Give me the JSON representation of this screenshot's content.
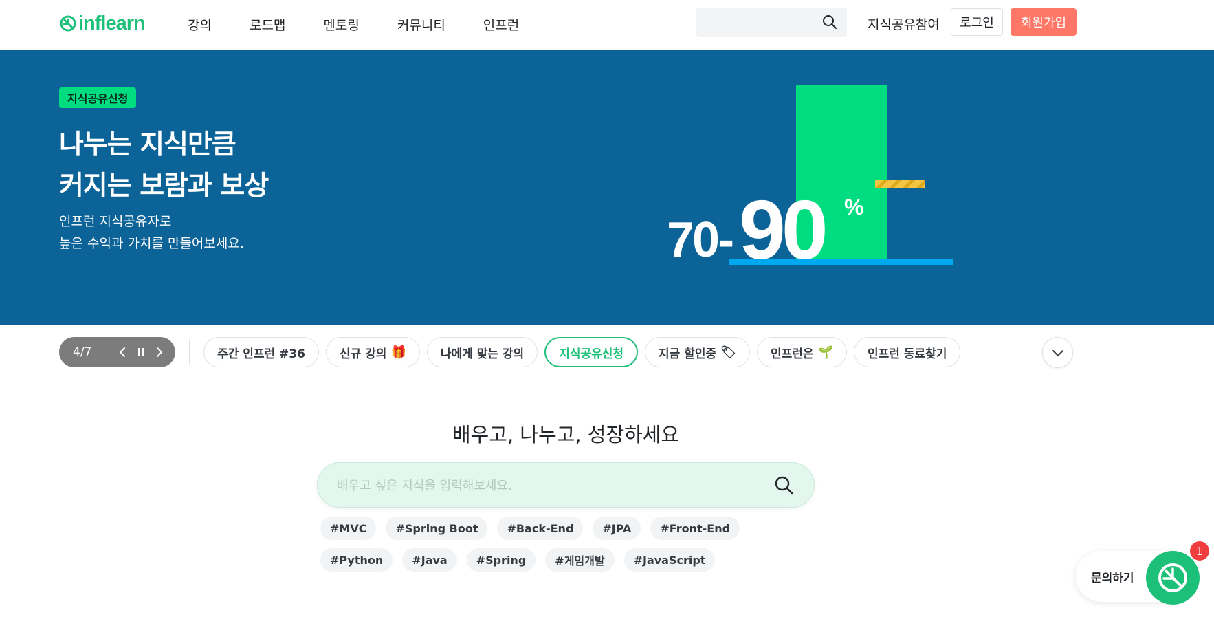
{
  "header": {
    "logo_text": "inflearn",
    "nav": [
      "강의",
      "로드맵",
      "멘토링",
      "커뮤니티",
      "인프런"
    ],
    "share_link": "지식공유참여",
    "login": "로그인",
    "signup": "회원가입"
  },
  "hero": {
    "badge": "지식공유신청",
    "title_line1": "나누는 지식만큼",
    "title_line2": "커지는 보람과 보상",
    "sub_line1": "인프런 지식공유자로",
    "sub_line2": "높은 수익과 가치를 만들어보세요.",
    "pct_small": "70-",
    "pct_big": "90",
    "pct_sign": "%",
    "bg_color": "#0b6397",
    "accent_color": "#00dd80"
  },
  "carousel": {
    "page": "4/7",
    "chips": [
      {
        "label": "주간 인프런 #36",
        "emoji": ""
      },
      {
        "label": "신규 강의",
        "emoji": "🎁"
      },
      {
        "label": "나에게 맞는 강의",
        "emoji": ""
      },
      {
        "label": "지식공유신청",
        "emoji": ""
      },
      {
        "label": "지금 할인중",
        "emoji": "🏷"
      },
      {
        "label": "인프런은",
        "emoji": "🌱"
      },
      {
        "label": "인프런 동료찾기",
        "emoji": ""
      }
    ]
  },
  "main": {
    "title": "배우고, 나누고, 성장하세요",
    "search_placeholder": "배우고 싶은 지식을 입력해보세요.",
    "tags": [
      "#MVC",
      "#Spring Boot",
      "#Back-End",
      "#JPA",
      "#Front-End",
      "#Python",
      "#Java",
      "#Spring",
      "#게임개발",
      "#JavaScript"
    ]
  },
  "help": {
    "label": "문의하기",
    "badge_count": "1"
  },
  "colors": {
    "brand": "#1dc078",
    "signup": "#ff7867"
  }
}
